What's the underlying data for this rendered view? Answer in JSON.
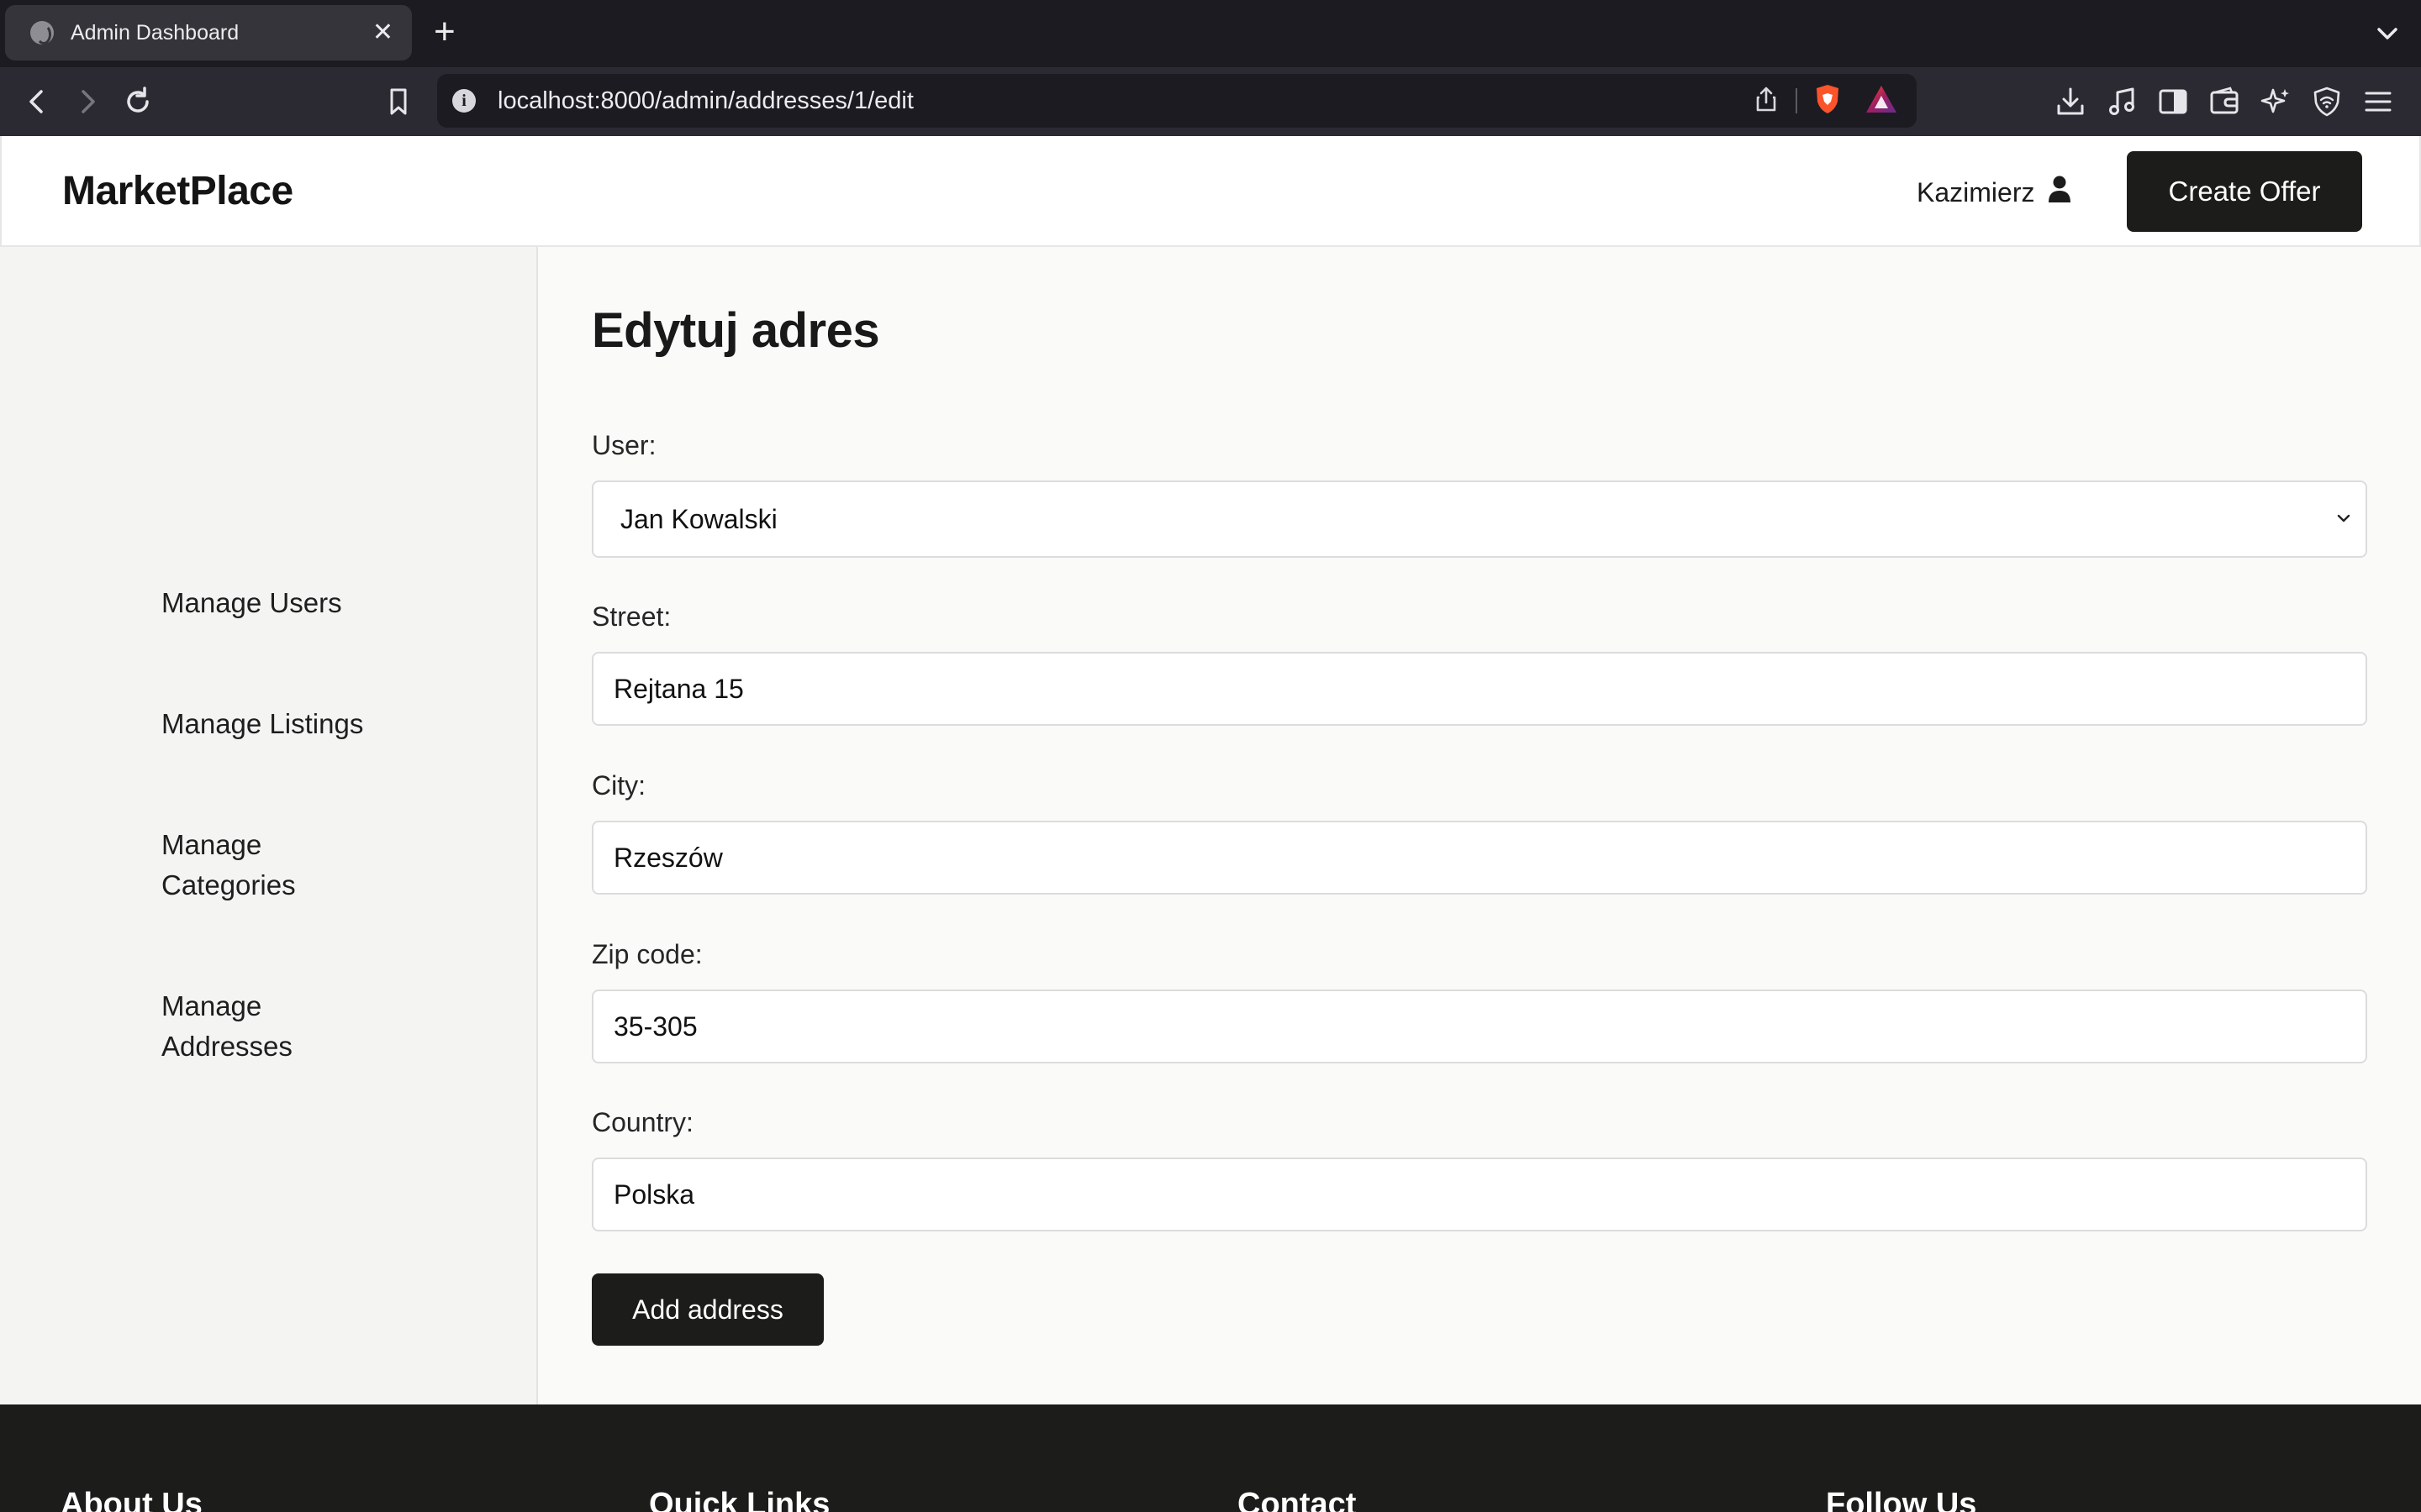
{
  "browser": {
    "tab_title": "Admin Dashboard",
    "tab_close": "✕",
    "new_tab": "+",
    "url": "localhost:8000/admin/addresses/1/edit",
    "info_glyph": "i"
  },
  "site": {
    "brand": "MarketPlace",
    "username": "Kazimierz",
    "create_offer_label": "Create Offer"
  },
  "sidebar": {
    "items": [
      {
        "label": "Manage Users"
      },
      {
        "label": "Manage Listings"
      },
      {
        "label": "Manage Categories"
      },
      {
        "label": "Manage Addresses"
      }
    ]
  },
  "form": {
    "title": "Edytuj adres",
    "user_label": "User:",
    "user_value": "Jan Kowalski",
    "street_label": "Street:",
    "street_value": "Rejtana 15",
    "city_label": "City:",
    "city_value": "Rzeszów",
    "zip_label": "Zip code:",
    "zip_value": "35-305",
    "country_label": "Country:",
    "country_value": "Polska",
    "submit_label": "Add address"
  },
  "footer": {
    "headings": [
      "About Us",
      "Quick Links",
      "Contact",
      "Follow Us"
    ]
  },
  "colors": {
    "dark": "#1c1c1a",
    "sidebar_bg": "#f4f4f3",
    "main_bg": "#fafaf9",
    "browser_bg": "#1c1b22"
  }
}
